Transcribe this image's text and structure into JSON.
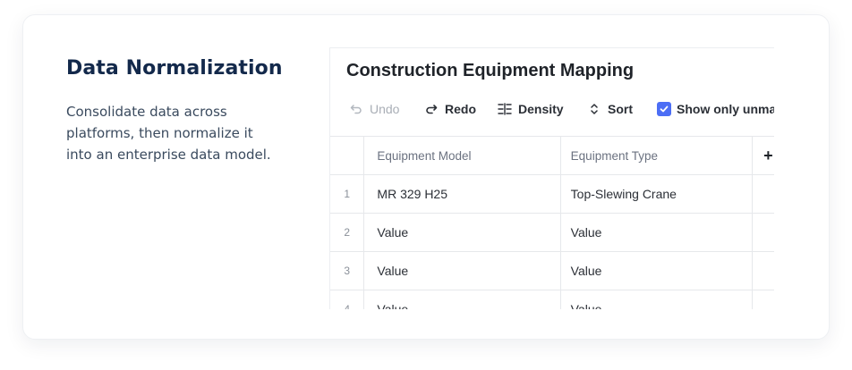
{
  "feature": {
    "title": "Data Normalization",
    "description": "Consolidate data across platforms, then normalize it into an enterprise data model."
  },
  "panel": {
    "title": "Construction Equipment Mapping",
    "toolbar": {
      "undo_label": "Undo",
      "redo_label": "Redo",
      "density_label": "Density",
      "sort_label": "Sort",
      "show_unmapped_label": "Show only unmapped",
      "show_unmapped_checked": true
    },
    "table": {
      "columns": [
        "Equipment Model",
        "Equipment Type"
      ],
      "add_column_icon": "+",
      "rows": [
        {
          "num": "1",
          "model": "MR 329 H25",
          "type": "Top-Slewing Crane"
        },
        {
          "num": "2",
          "model": "Value",
          "type": "Value"
        },
        {
          "num": "3",
          "model": "Value",
          "type": "Value"
        },
        {
          "num": "4",
          "model": "Value",
          "type": "Value"
        }
      ]
    }
  },
  "colors": {
    "title": "#13294b",
    "body_text": "#3a4a5e",
    "checkbox_accent": "#4c6ef5",
    "disabled": "#a9aeb6"
  },
  "icons": {
    "undo": "undo-icon",
    "redo": "redo-icon",
    "density": "density-icon",
    "sort": "sort-icon",
    "checkbox": "check-icon",
    "add_column": "plus-icon"
  }
}
